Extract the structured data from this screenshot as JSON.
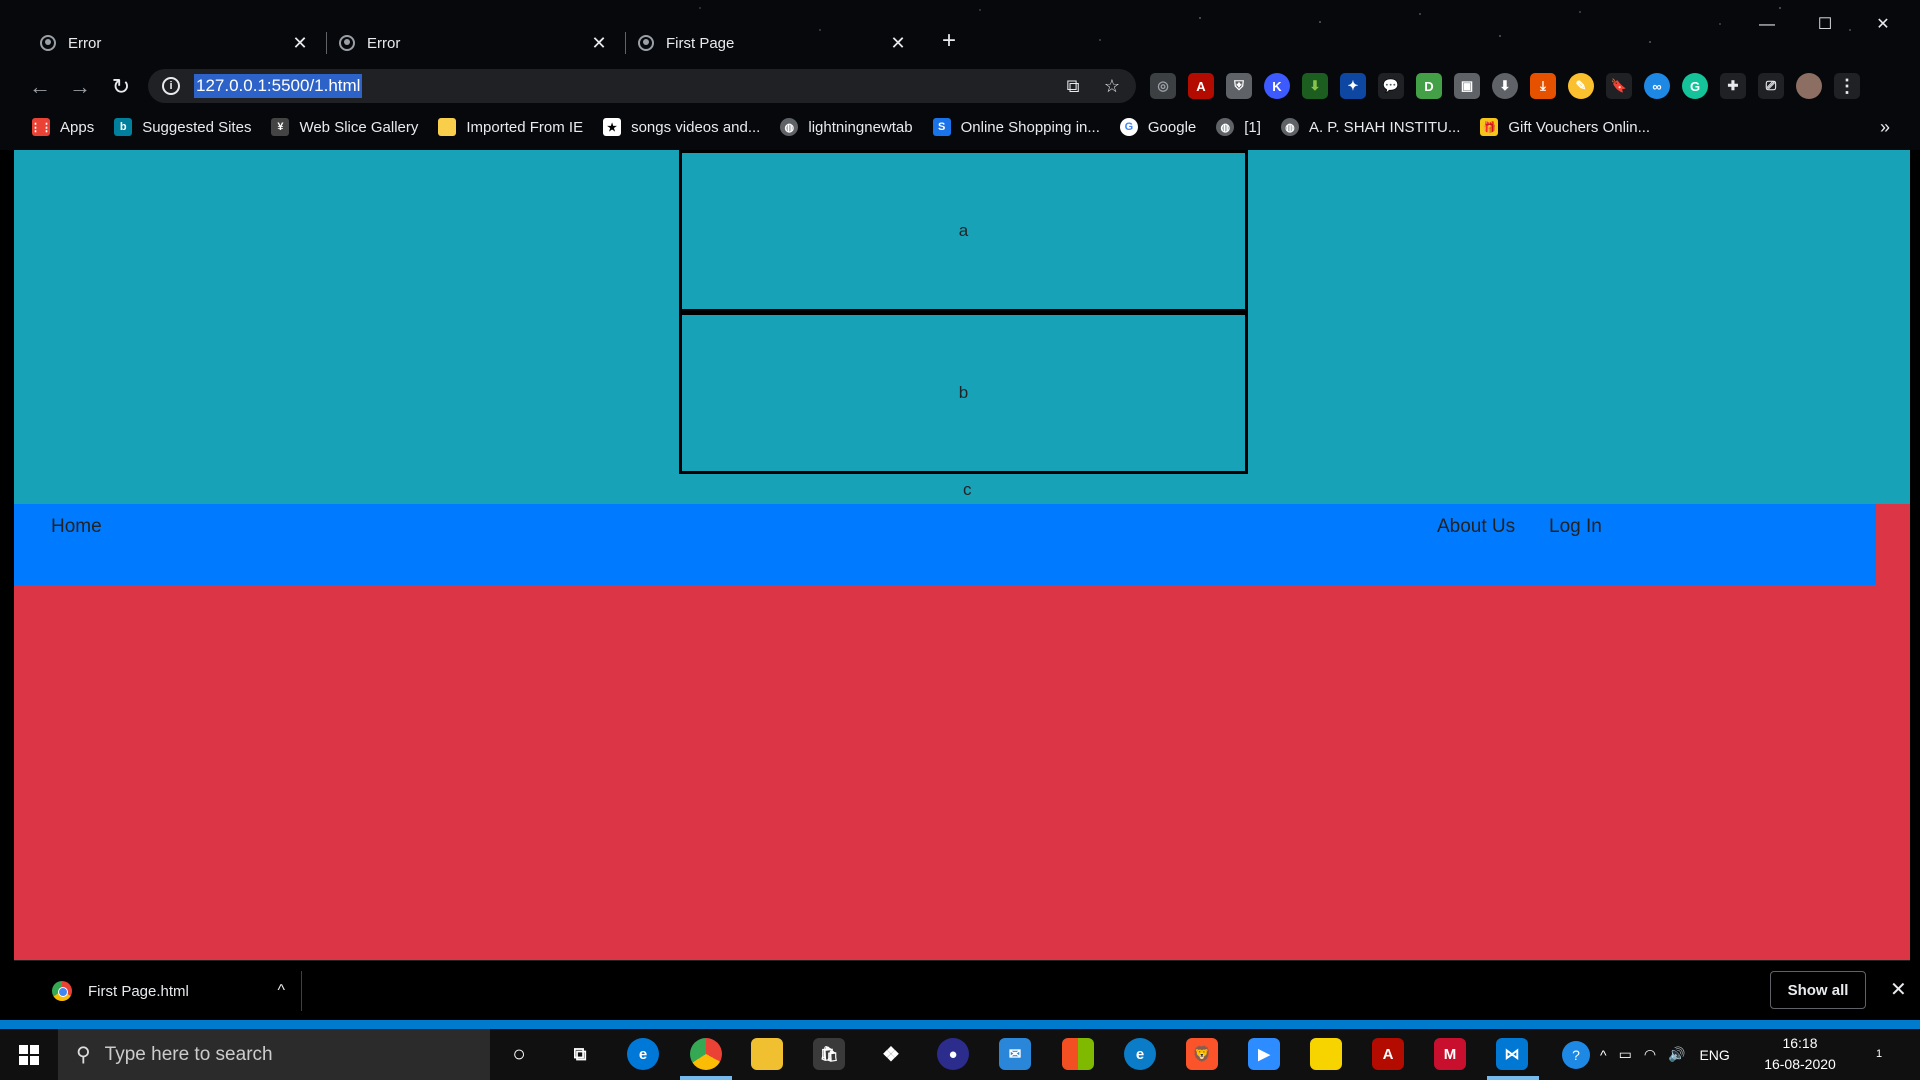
{
  "browser": {
    "tabs": [
      {
        "title": "Error"
      },
      {
        "title": "Error"
      },
      {
        "title": "First Page"
      }
    ],
    "url": "127.0.0.1:5500/1.html",
    "bookmarks": [
      {
        "label": "Apps",
        "icon": "apps-grid-icon",
        "color": "#ea4335"
      },
      {
        "label": "Suggested Sites",
        "icon": "bing-icon",
        "color": "#00809d"
      },
      {
        "label": "Web Slice Gallery",
        "icon": "web-slice-icon",
        "color": "#888888"
      },
      {
        "label": "Imported From IE",
        "icon": "folder-icon",
        "color": "#f9ce4b"
      },
      {
        "label": "songs videos and...",
        "icon": "star-icon",
        "color": "#ffffff"
      },
      {
        "label": "lightningnewtab",
        "icon": "globe-icon",
        "color": "#9aa0a6"
      },
      {
        "label": "Online Shopping in...",
        "icon": "snapdeal-icon",
        "color": "#1a73e8"
      },
      {
        "label": "Google",
        "icon": "google-icon",
        "color": "#4285f4"
      },
      {
        "label": "[1]",
        "icon": "globe-icon",
        "color": "#9aa0a6"
      },
      {
        "label": "A. P. SHAH INSTITU...",
        "icon": "globe-icon",
        "color": "#9aa0a6"
      },
      {
        "label": "Gift Vouchers Onlin...",
        "icon": "gift-icon",
        "color": "#f5c518"
      }
    ]
  },
  "page": {
    "box_a": "a",
    "box_b": "b",
    "label_c": "c",
    "nav": {
      "home": "Home",
      "about": "About Us",
      "login": "Log In"
    },
    "colors": {
      "cyan": "#17a2b8",
      "blue": "#007bff",
      "red": "#dc3545"
    }
  },
  "downloads": {
    "file_name": "First Page.html",
    "show_all": "Show all"
  },
  "taskbar": {
    "search_placeholder": "Type here to search",
    "language": "ENG",
    "time": "16:18",
    "date": "16-08-2020",
    "notification_count": "1"
  }
}
